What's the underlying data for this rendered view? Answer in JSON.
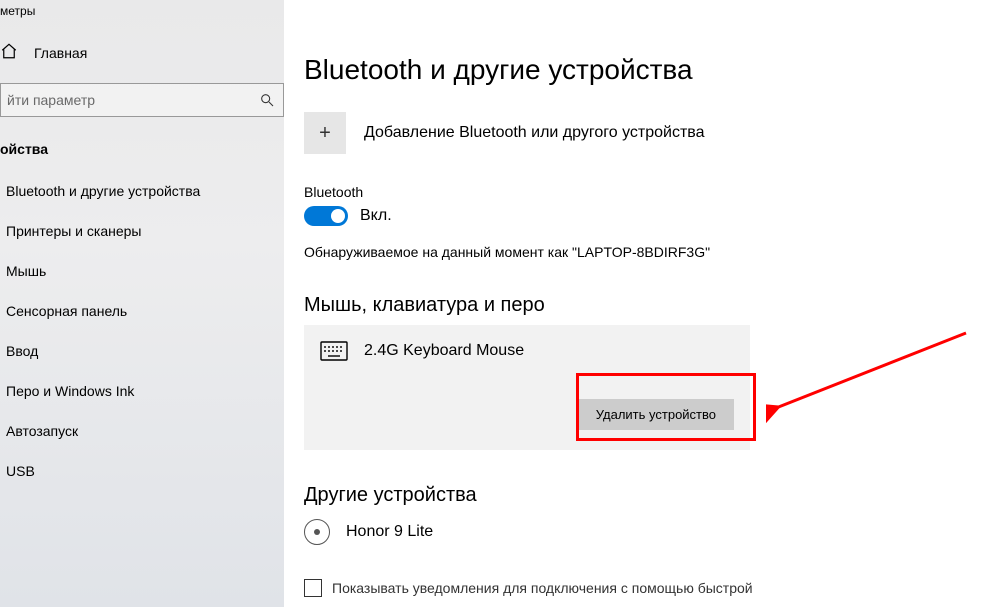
{
  "window": {
    "title_fragment": "метры"
  },
  "sidebar": {
    "home_label": "Главная",
    "search_placeholder": "йти параметр",
    "section_header": "ойства",
    "items": [
      {
        "label": "Bluetooth и другие устройства"
      },
      {
        "label": "Принтеры и сканеры"
      },
      {
        "label": "Мышь"
      },
      {
        "label": "Сенсорная панель"
      },
      {
        "label": "Ввод"
      },
      {
        "label": "Перо и Windows Ink"
      },
      {
        "label": "Автозапуск"
      },
      {
        "label": "USB"
      }
    ]
  },
  "main": {
    "heading": "Bluetooth и другие устройства",
    "add_device_label": "Добавление Bluetooth или другого устройства",
    "bluetooth_label": "Bluetooth",
    "toggle_state_label": "Вкл.",
    "discoverable_text": "Обнаруживаемое на данный момент как \"LAPTOP-8BDIRF3G\"",
    "section_input": "Мышь, клавиатура и перо",
    "device1": {
      "name": "2.4G Keyboard Mouse"
    },
    "remove_button": "Удалить устройство",
    "section_other": "Другие устройства",
    "device2": {
      "name": "Honor 9 Lite"
    },
    "notifications_checkbox_fragment": "Показывать уведомления для подключения с помощью быстрой"
  }
}
